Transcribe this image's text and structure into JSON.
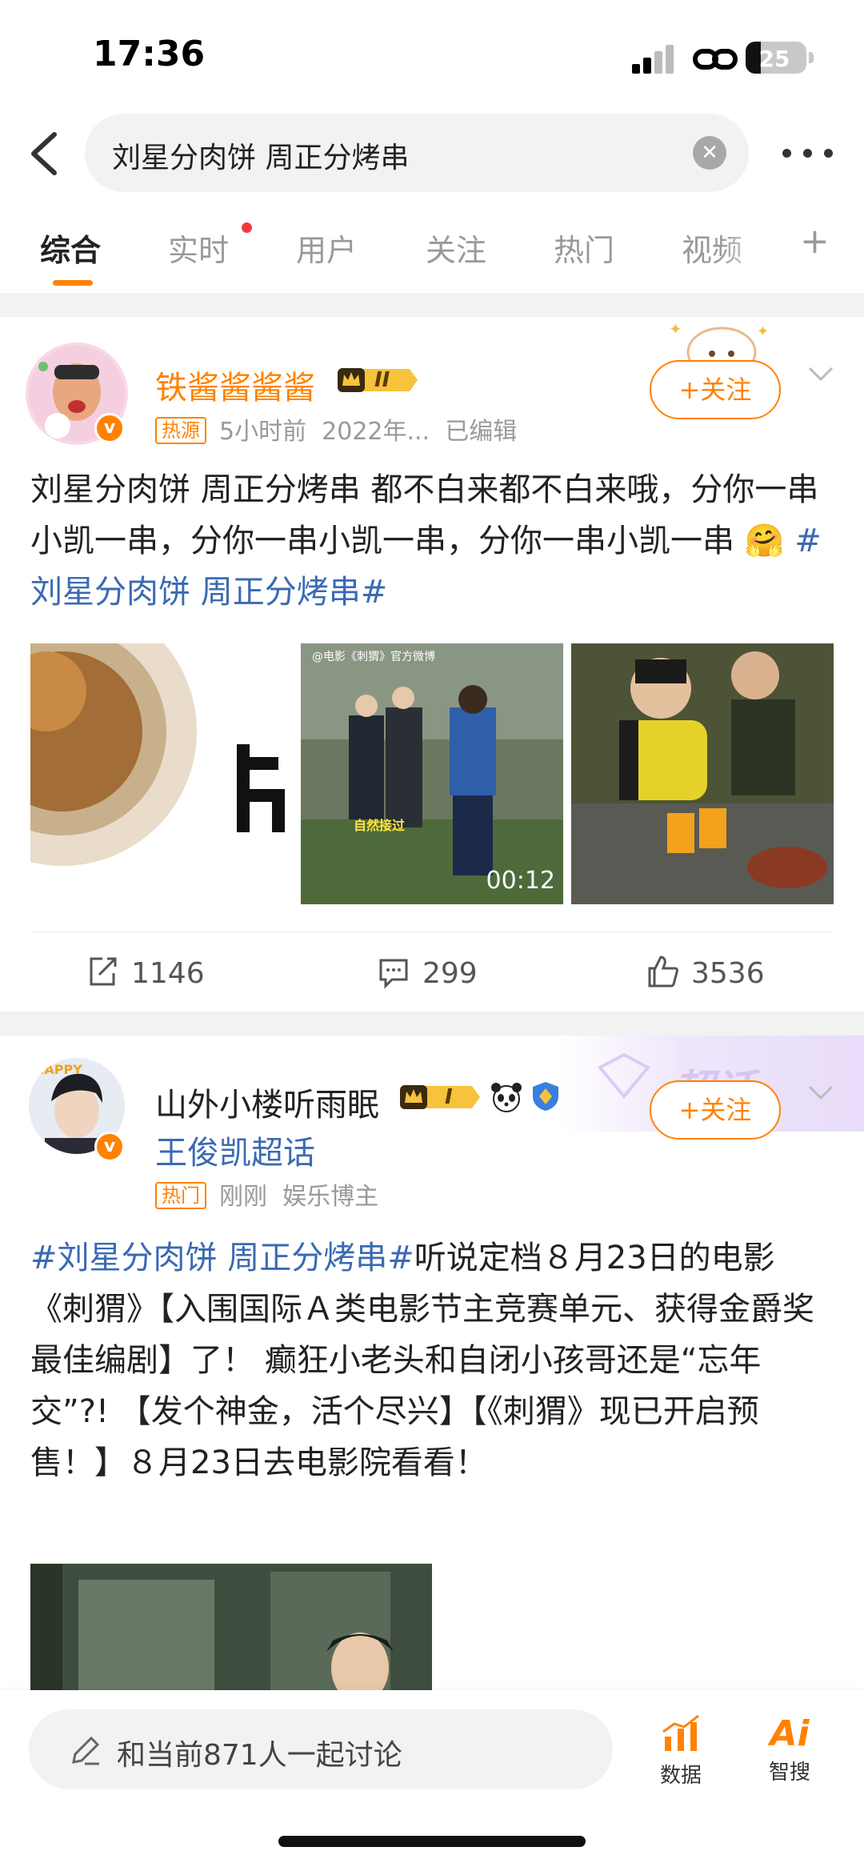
{
  "status_bar": {
    "time": "17:36",
    "battery": "25"
  },
  "search": {
    "query": "刘星分肉饼 周正分烤串"
  },
  "tabs": [
    {
      "label": "综合"
    },
    {
      "label": "实时"
    },
    {
      "label": "用户"
    },
    {
      "label": "关注"
    },
    {
      "label": "热门"
    },
    {
      "label": "视频"
    }
  ],
  "posts": [
    {
      "username": "铁酱酱酱酱",
      "level": "II",
      "tag": "热源",
      "time": "5小时前",
      "date": "2022年...",
      "edited": "已编辑",
      "follow": "+关注",
      "text": "刘星分肉饼 周正分烤串 都不白来都不白来哦，分你一串小凯一串，分你一串小凯一串，分你一串小凯一串",
      "emoji": "🤗",
      "topic": "#刘星分肉饼 周正分烤串#",
      "video_watermark": "@电影《刺猬》官方微博",
      "video_caption": "自然接过",
      "video_duration": "00:12",
      "reposts": "1146",
      "comments": "299",
      "likes": "3536"
    },
    {
      "username": "山外小楼听雨眠",
      "level": "I",
      "supertopic": "王俊凯超话",
      "tag": "热门",
      "time": "刚刚",
      "role": "娱乐博主",
      "follow": "+关注",
      "topic": "#刘星分肉饼 周正分烤串#",
      "text": "听说定档８月23日的电影《刺猬》【入围国际Ａ类电影节主竞赛单元、获得金爵奖最佳编剧】了！ 癫狂小老头和自闭小孩哥还是“忘年交”?! 【发个神金，活个尽兴】【《刺猬》现已开启预售！】８月23日去电影院看看！",
      "banner_text": "超话"
    }
  ],
  "bottom_bar": {
    "comment_placeholder": "和当前871人一起讨论",
    "data_label": "数据",
    "ai_label": "智搜"
  }
}
